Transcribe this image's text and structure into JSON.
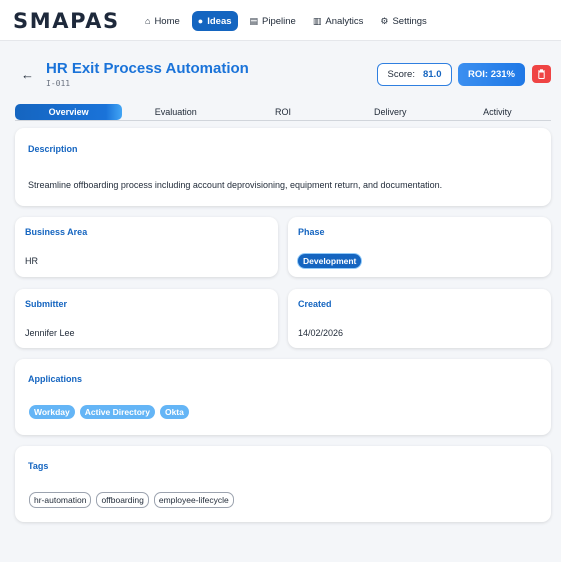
{
  "app": {
    "logo": "SMAPAS"
  },
  "nav": {
    "items": [
      {
        "icon": "⌂",
        "label": "Home"
      },
      {
        "icon": "●",
        "label": "Ideas",
        "active": true
      },
      {
        "icon": "▤",
        "label": "Pipeline"
      },
      {
        "icon": "▥",
        "label": "Analytics"
      },
      {
        "icon": "⚙",
        "label": "Settings"
      }
    ]
  },
  "header": {
    "back": "←",
    "title": "HR Exit Process Automation",
    "code": "I-011",
    "score_label": "Score:",
    "score_value": "81.0",
    "roi_label": "ROI: 231%"
  },
  "tabs": [
    {
      "label": "Overview",
      "active": true
    },
    {
      "label": "Evaluation"
    },
    {
      "label": "ROI"
    },
    {
      "label": "Delivery"
    },
    {
      "label": "Activity"
    }
  ],
  "description": {
    "label": "Description",
    "text": "Streamline offboarding process including account deprovisioning, equipment return, and documentation."
  },
  "business_area": {
    "label": "Business Area",
    "value": "HR"
  },
  "phase": {
    "label": "Phase",
    "value": "Development"
  },
  "submitter": {
    "label": "Submitter",
    "value": "Jennifer Lee"
  },
  "created": {
    "label": "Created",
    "value": "14/02/2026"
  },
  "applications": {
    "label": "Applications",
    "items": [
      "Workday",
      "Active Directory",
      "Okta"
    ]
  },
  "tags": {
    "label": "Tags",
    "items": [
      "hr-automation",
      "offboarding",
      "employee-lifecycle"
    ]
  },
  "colors": {
    "accent": "#1565c0",
    "title": "#1a73d9",
    "danger": "#ef4444",
    "app_pill": "#64b5f6"
  }
}
